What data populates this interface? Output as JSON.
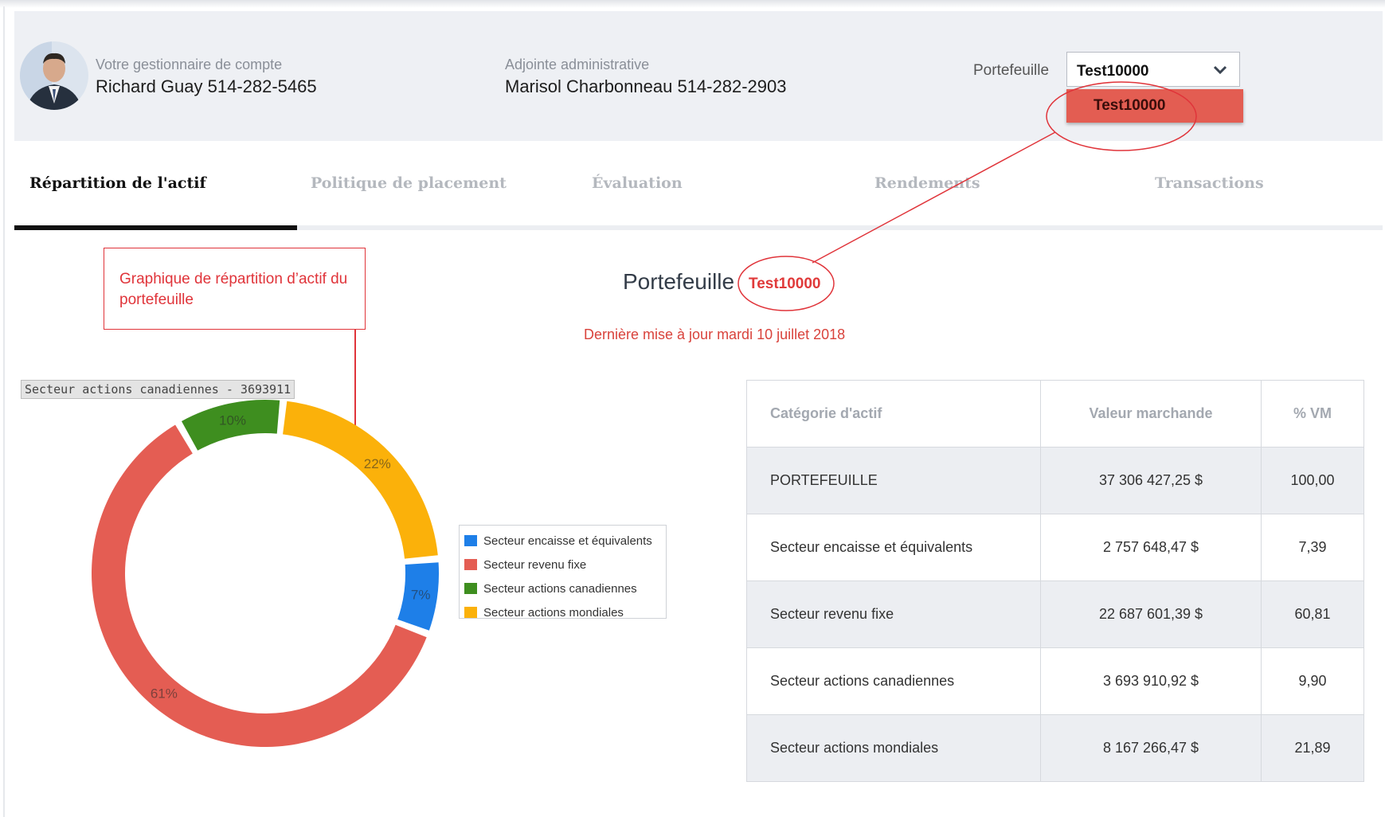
{
  "header": {
    "manager_caption": "Votre gestionnaire de compte",
    "manager_contact": "Richard Guay 514-282-5465",
    "assistant_caption": "Adjointe administrative",
    "assistant_contact": "Marisol Charbonneau 514-282-2903",
    "portfolio_label": "Portefeuille",
    "portfolio_selected": "Test10000",
    "portfolio_options": [
      "Test10000"
    ]
  },
  "tabs": [
    {
      "label": "Répartition de l'actif",
      "active": true
    },
    {
      "label": "Politique de placement",
      "active": false
    },
    {
      "label": "Évaluation",
      "active": false
    },
    {
      "label": "Rendements",
      "active": false
    },
    {
      "label": "Transactions",
      "active": false
    }
  ],
  "annotation": {
    "text": "Graphique de répartition d’actif du portefeuille"
  },
  "main": {
    "title": "Portefeuille",
    "portfolio_code": "Test10000",
    "last_update": "Dernière mise à jour mardi 10 juillet 2018"
  },
  "chart_tooltip": "Secteur actions canadiennes - 3693911",
  "chart_data": {
    "type": "pie",
    "donut": true,
    "categories": [
      "Secteur encaisse et équivalents",
      "Secteur revenu fixe",
      "Secteur actions canadiennes",
      "Secteur actions mondiales"
    ],
    "values": [
      7,
      61,
      10,
      22
    ],
    "labels": [
      "7%",
      "61%",
      "10%",
      "22%"
    ],
    "colors": [
      "#1e7fe8",
      "#e45d53",
      "#3e8e1f",
      "#fbb10a"
    ],
    "legend_position": "right"
  },
  "table": {
    "headers": [
      "Catégorie d'actif",
      "Valeur marchande",
      "% VM"
    ],
    "rows": [
      [
        "PORTEFEUILLE",
        "37 306 427,25 $",
        "100,00"
      ],
      [
        "Secteur encaisse et équivalents",
        "2 757 648,47 $",
        "7,39"
      ],
      [
        "Secteur revenu fixe",
        "22 687 601,39 $",
        "60,81"
      ],
      [
        "Secteur actions canadiennes",
        "3 693 910,92 $",
        "9,90"
      ],
      [
        "Secteur actions mondiales",
        "8 167 266,47 $",
        "21,89"
      ]
    ]
  },
  "colors": {
    "accent_red": "#e35d52",
    "header_bg": "#eef0f4",
    "annotation": "#e0343a"
  }
}
